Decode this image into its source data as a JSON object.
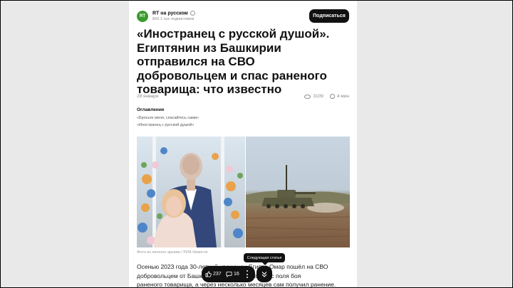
{
  "channel": {
    "logo_text": "RT",
    "name": "RT на русском",
    "subscribers": "843.1 тыс подписчиков",
    "subscribe_label": "Подписаться"
  },
  "article": {
    "title": "«Иностранец с русской душой». Египтянин из Башкирии отправился на СВО добровольцем и спас раненого товарища: что известно",
    "date": "28 января",
    "views": "3109",
    "read_time": "4 мин",
    "toc_title": "Оглавление",
    "toc": [
      "«Бросьте меня, спасайтесь сами»",
      "«Иностранец с русской душой»"
    ],
    "photo_caption": "Фото из личного архива / РИА Новости",
    "body_line1": "Осенью 2023 года 30-летний уроженец Египта Омар пошёл на СВО",
    "body_line2": "добровольцем от Башкортостана. Он вытащил с поля боя",
    "body_line3": "раненого товарища, а через несколько месяцев сам получил ранение. Мужчина"
  },
  "actions": {
    "likes": "237",
    "comments": "16",
    "next_tooltip": "Следующая статья"
  },
  "colors": {
    "logo": "#3a9a2e",
    "button": "#111111"
  }
}
